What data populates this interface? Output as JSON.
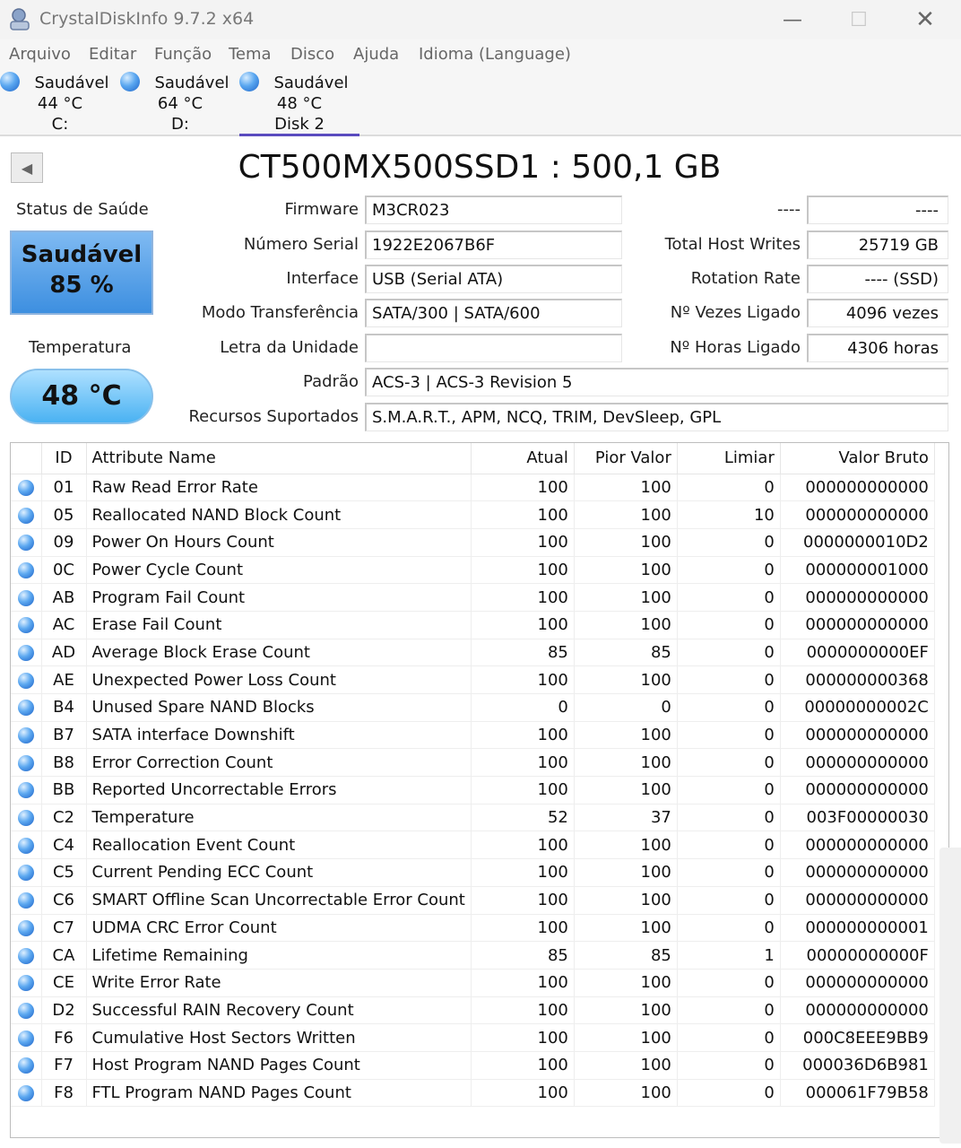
{
  "window": {
    "title": "CrystalDiskInfo 9.7.2 x64"
  },
  "menu": [
    "Arquivo",
    "Editar",
    "Função",
    "Tema",
    "Disco",
    "Ajuda",
    "Idioma (Language)"
  ],
  "disks": [
    {
      "status": "Saudável",
      "temp": "44 °C",
      "label": "C:"
    },
    {
      "status": "Saudável",
      "temp": "64 °C",
      "label": "D:"
    },
    {
      "status": "Saudável",
      "temp": "48 °C",
      "label": "Disk 2"
    }
  ],
  "model_title": "CT500MX500SSD1 : 500,1 GB",
  "health": {
    "label": "Status de Saúde",
    "status": "Saudável",
    "percent": "85 %"
  },
  "temperature": {
    "label": "Temperatura",
    "value": "48 °C"
  },
  "info": {
    "firmware_label": "Firmware",
    "firmware": "M3CR023",
    "serial_label": "Número Serial",
    "serial": "1922E2067B6F",
    "interface_label": "Interface",
    "interface": "USB (Serial ATA)",
    "transfer_label": "Modo Transferência",
    "transfer": "SATA/300 | SATA/600",
    "letter_label": "Letra da Unidade",
    "letter": "",
    "standard_label": "Padrão",
    "standard": "ACS-3 | ACS-3 Revision 5",
    "features_label": "Recursos Suportados",
    "features": "S.M.A.R.T., APM, NCQ, TRIM, DevSleep, GPL",
    "blank_label": "----",
    "blank_value": "----",
    "host_writes_label": "Total Host Writes",
    "host_writes": "25719 GB",
    "rotation_label": "Rotation Rate",
    "rotation": "---- (SSD)",
    "power_count_label": "Nº Vezes Ligado",
    "power_count": "4096 vezes",
    "power_hours_label": "Nº Horas Ligado",
    "power_hours": "4306 horas"
  },
  "smart": {
    "headers": [
      "ID",
      "Attribute Name",
      "Atual",
      "Pior Valor",
      "Limiar",
      "Valor Bruto"
    ],
    "rows": [
      [
        "01",
        "Raw Read Error Rate",
        "100",
        "100",
        "0",
        "000000000000"
      ],
      [
        "05",
        "Reallocated NAND Block Count",
        "100",
        "100",
        "10",
        "000000000000"
      ],
      [
        "09",
        "Power On Hours Count",
        "100",
        "100",
        "0",
        "0000000010D2"
      ],
      [
        "0C",
        "Power Cycle Count",
        "100",
        "100",
        "0",
        "000000001000"
      ],
      [
        "AB",
        "Program Fail Count",
        "100",
        "100",
        "0",
        "000000000000"
      ],
      [
        "AC",
        "Erase Fail Count",
        "100",
        "100",
        "0",
        "000000000000"
      ],
      [
        "AD",
        "Average Block Erase Count",
        "85",
        "85",
        "0",
        "0000000000EF"
      ],
      [
        "AE",
        "Unexpected Power Loss Count",
        "100",
        "100",
        "0",
        "000000000368"
      ],
      [
        "B4",
        "Unused Spare NAND Blocks",
        "0",
        "0",
        "0",
        "00000000002C"
      ],
      [
        "B7",
        "SATA interface Downshift",
        "100",
        "100",
        "0",
        "000000000000"
      ],
      [
        "B8",
        "Error Correction Count",
        "100",
        "100",
        "0",
        "000000000000"
      ],
      [
        "BB",
        "Reported Uncorrectable Errors",
        "100",
        "100",
        "0",
        "000000000000"
      ],
      [
        "C2",
        "Temperature",
        "52",
        "37",
        "0",
        "003F00000030"
      ],
      [
        "C4",
        "Reallocation Event Count",
        "100",
        "100",
        "0",
        "000000000000"
      ],
      [
        "C5",
        "Current Pending ECC Count",
        "100",
        "100",
        "0",
        "000000000000"
      ],
      [
        "C6",
        "SMART Offline Scan Uncorrectable Error Count",
        "100",
        "100",
        "0",
        "000000000000"
      ],
      [
        "C7",
        "UDMA CRC Error Count",
        "100",
        "100",
        "0",
        "000000000001"
      ],
      [
        "CA",
        "Lifetime Remaining",
        "85",
        "85",
        "1",
        "00000000000F"
      ],
      [
        "CE",
        "Write Error Rate",
        "100",
        "100",
        "0",
        "000000000000"
      ],
      [
        "D2",
        "Successful RAIN Recovery Count",
        "100",
        "100",
        "0",
        "000000000000"
      ],
      [
        "F6",
        "Cumulative Host Sectors Written",
        "100",
        "100",
        "0",
        "000C8EEE9BB9"
      ],
      [
        "F7",
        "Host Program NAND Pages Count",
        "100",
        "100",
        "0",
        "000036D6B981"
      ],
      [
        "F8",
        "FTL Program NAND Pages Count",
        "100",
        "100",
        "0",
        "000061F79B58"
      ]
    ]
  }
}
